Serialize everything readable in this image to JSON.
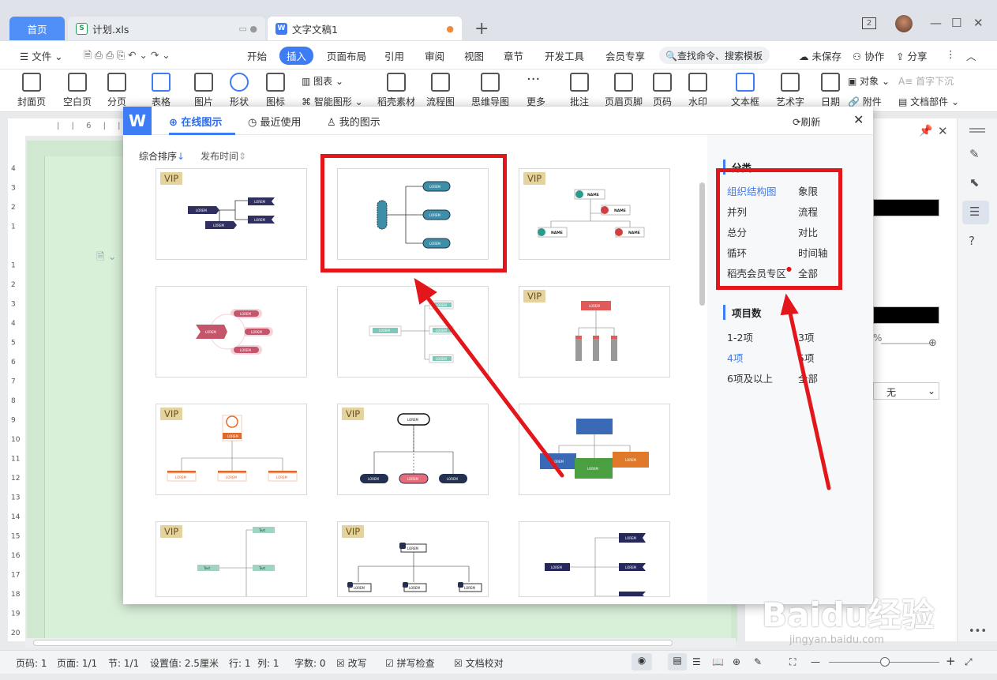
{
  "tabs": {
    "home": "首页",
    "xls": "计划.xls",
    "doc": "文字文稿1"
  },
  "window": {
    "badge": "2"
  },
  "menu": {
    "file": "文件",
    "items": [
      "开始",
      "插入",
      "页面布局",
      "引用",
      "审阅",
      "视图",
      "章节",
      "开发工具",
      "会员专享"
    ],
    "search": "查找命令、搜索模板",
    "unsaved": "未保存",
    "collab": "协作",
    "share": "分享"
  },
  "ribbon": {
    "big": [
      "封面页",
      "空白页",
      "分页",
      "表格",
      "图片",
      "形状",
      "图标",
      "稻壳素材",
      "流程图",
      "思维导图",
      "更多",
      "批注",
      "页眉页脚",
      "页码",
      "水印",
      "文本框",
      "艺术字",
      "日期"
    ],
    "chart": "图表",
    "smart": "智能图形",
    "object": "对象",
    "dropcap": "首字下沉",
    "attach": "附件",
    "docpart": "文档部件"
  },
  "dialog": {
    "tabs": [
      "在线图示",
      "最近使用",
      "我的图示"
    ],
    "refresh": "刷新",
    "sort": [
      "综合排序",
      "发布时间"
    ],
    "vip_label": "VIP",
    "card_text": {
      "lorem": "LOREM",
      "name": "NAME",
      "text": "Text"
    },
    "category_title": "分类",
    "categories": [
      "组织结构图",
      "象限",
      "并列",
      "流程",
      "总分",
      "对比",
      "循环",
      "时间轴",
      "稻壳会员专区",
      "全部"
    ],
    "count_title": "项目数",
    "counts": [
      "1-2项",
      "3项",
      "4项",
      "5项",
      "6项及以上",
      "全部"
    ]
  },
  "rightpanel": {
    "percent": "%",
    "none": "无"
  },
  "statusbar": {
    "items": [
      "页码: 1",
      "页面: 1/1",
      "节: 1/1",
      "设置值: 2.5厘米",
      "行: 1",
      "列: 1",
      "字数: 0",
      "改写",
      "拼写检查",
      "文档校对"
    ]
  },
  "watermark": {
    "main": "Baidu经验",
    "sub": "jingyan.baidu.com"
  }
}
